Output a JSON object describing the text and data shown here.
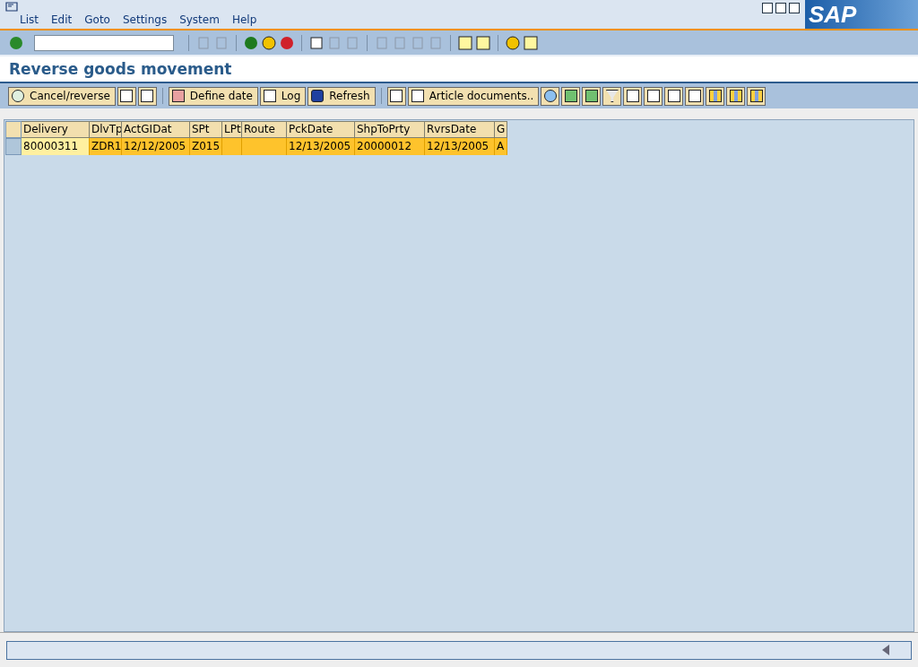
{
  "menu": [
    "List",
    "Edit",
    "Goto",
    "Settings",
    "System",
    "Help"
  ],
  "logo": "SAP",
  "title": "Reverse goods movement",
  "app_toolbar": [
    {
      "kind": "text",
      "label": "Cancel/reverse"
    },
    {
      "kind": "icon"
    },
    {
      "kind": "icon"
    },
    {
      "kind": "sep"
    },
    {
      "kind": "text",
      "label": "Define date"
    },
    {
      "kind": "text",
      "label": "Log"
    },
    {
      "kind": "text",
      "label": "Refresh"
    },
    {
      "kind": "sep"
    },
    {
      "kind": "icon"
    },
    {
      "kind": "text",
      "label": "Article documents.."
    },
    {
      "kind": "icon"
    },
    {
      "kind": "icon"
    },
    {
      "kind": "icon"
    },
    {
      "kind": "icon"
    },
    {
      "kind": "icon"
    },
    {
      "kind": "icon"
    },
    {
      "kind": "icon"
    },
    {
      "kind": "icon"
    },
    {
      "kind": "icon"
    },
    {
      "kind": "icon"
    },
    {
      "kind": "icon"
    }
  ],
  "table": {
    "columns": [
      "Delivery",
      "DlvTp",
      "ActGIDat",
      "SPt",
      "LPt",
      "Route",
      "PckDate",
      "ShpToPrty",
      "RvrsDate",
      "G"
    ],
    "rows": [
      {
        "cells": [
          "80000311",
          "ZDR1",
          "12/12/2005",
          "Z015",
          "",
          "",
          "12/13/2005",
          "20000012",
          "12/13/2005",
          "A"
        ]
      }
    ]
  }
}
